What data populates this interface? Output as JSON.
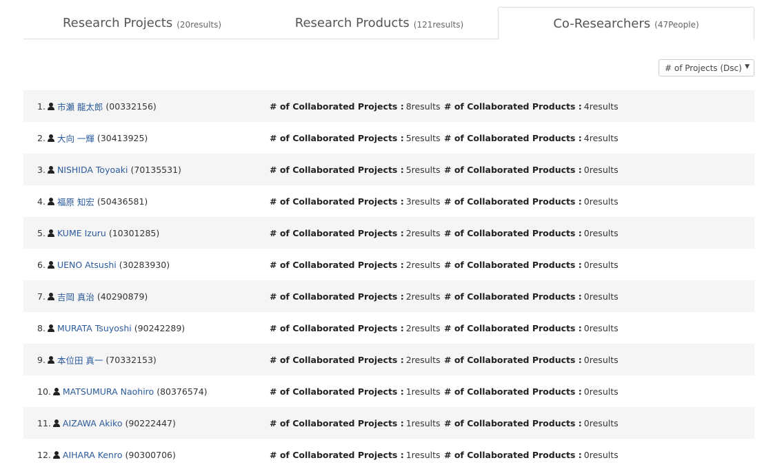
{
  "tabs": [
    {
      "label": "Research Projects",
      "count": "(20results)"
    },
    {
      "label": "Research Products",
      "count": "(121results)"
    },
    {
      "label": "Co-Researchers",
      "count": "(47People)"
    }
  ],
  "sort": {
    "selected": "# of Projects (Dsc)"
  },
  "labels": {
    "projects": "# of Collaborated Projects :",
    "products": "# of Collaborated Products :"
  },
  "researchers": [
    {
      "rank": "1.",
      "name": "市瀬 龍太郎",
      "id": "(00332156)",
      "projects": "8results",
      "products": "4results"
    },
    {
      "rank": "2.",
      "name": "大向 一輝",
      "id": "(30413925)",
      "projects": "5results",
      "products": "4results"
    },
    {
      "rank": "3.",
      "name": "NISHIDA Toyoaki",
      "id": "(70135531)",
      "projects": "5results",
      "products": "0results"
    },
    {
      "rank": "4.",
      "name": "福原 知宏",
      "id": "(50436581)",
      "projects": "3results",
      "products": "0results"
    },
    {
      "rank": "5.",
      "name": "KUME Izuru",
      "id": "(10301285)",
      "projects": "2results",
      "products": "0results"
    },
    {
      "rank": "6.",
      "name": "UENO Atsushi",
      "id": "(30283930)",
      "projects": "2results",
      "products": "0results"
    },
    {
      "rank": "7.",
      "name": "吉岡 真治",
      "id": "(40290879)",
      "projects": "2results",
      "products": "0results"
    },
    {
      "rank": "8.",
      "name": "MURATA Tsuyoshi",
      "id": "(90242289)",
      "projects": "2results",
      "products": "0results"
    },
    {
      "rank": "9.",
      "name": "本位田 真一",
      "id": "(70332153)",
      "projects": "2results",
      "products": "0results"
    },
    {
      "rank": "10.",
      "name": "MATSUMURA Naohiro",
      "id": "(80376574)",
      "projects": "1results",
      "products": "0results"
    },
    {
      "rank": "11.",
      "name": "AIZAWA Akiko",
      "id": "(90222447)",
      "projects": "1results",
      "products": "0results"
    },
    {
      "rank": "12.",
      "name": "AIHARA Kenro",
      "id": "(90300706)",
      "projects": "1results",
      "products": "0results"
    }
  ]
}
